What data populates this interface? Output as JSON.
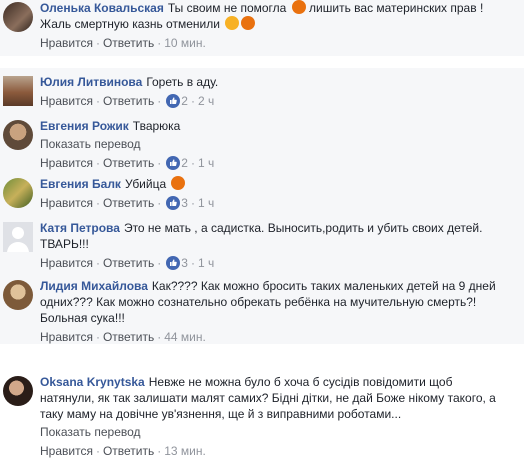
{
  "comments": [
    {
      "author": "Оленька Ковальская",
      "text_a": "Ты своим не помогла",
      "text_b": "лишить вас материнских прав ! Жаль смертную казнь отменили",
      "like_label": "Нравится",
      "reply_label": "Ответить",
      "time": "10 мин."
    },
    {
      "author": "Юлия Литвинова",
      "text": "Гореть в аду.",
      "like_label": "Нравится",
      "reply_label": "Ответить",
      "reactions": "2",
      "time": "2 ч"
    },
    {
      "author": "Евгения Рожик",
      "text": "Тварюка",
      "translate": "Показать перевод",
      "like_label": "Нравится",
      "reply_label": "Ответить",
      "reactions": "2",
      "time": "1 ч"
    },
    {
      "author": "Евгения Балк",
      "text": "Убийца",
      "like_label": "Нравится",
      "reply_label": "Ответить",
      "reactions": "3",
      "time": "1 ч"
    },
    {
      "author": "Катя Петрова",
      "text": "Это не мать , а садистка. Выносить,родить и убить своих детей. ТВАРЬ!!!",
      "like_label": "Нравится",
      "reply_label": "Ответить",
      "reactions": "3",
      "time": "1 ч"
    },
    {
      "author": "Лидия Михайлова",
      "text": "Как???? Как можно бросить таких маленьких детей на 9 дней одних??? Как можно сознательно обрекать ребёнка на мучительную смерть?! Больная сука!!!",
      "like_label": "Нравится",
      "reply_label": "Ответить",
      "time": "44 мин."
    },
    {
      "author": "Oksana Krynytska",
      "text": "Невже не можна було б хоча б сусідів повідомити щоб натянули, як так залишати малят самих? Бідні дітки, не дай Боже нікому такого, а таку маму на довічне ув'язнення, ще й з виправними роботами...",
      "translate": "Показать перевод",
      "like_label": "Нравится",
      "reply_label": "Ответить",
      "time": "13 мин."
    }
  ],
  "colors": {
    "author": "#365899",
    "like": "#4267b2",
    "angry": "#e9710f",
    "laugh": "#f7b125"
  }
}
